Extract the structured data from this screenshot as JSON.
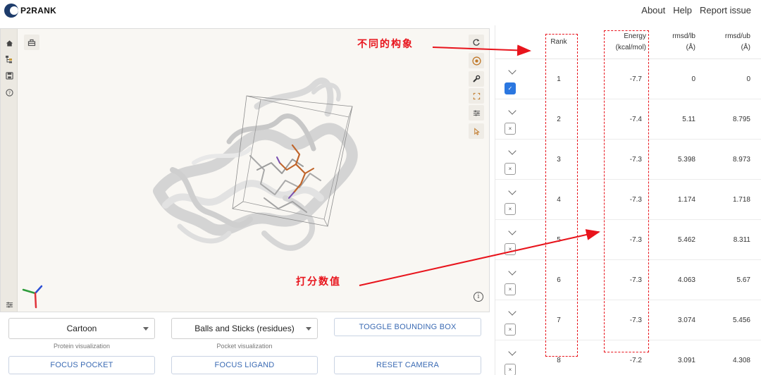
{
  "header": {
    "brand": "P2RANK",
    "links": [
      "About",
      "Help",
      "Report issue"
    ]
  },
  "viewer": {
    "left_icons": [
      "home-icon",
      "hierarchy-icon",
      "save-icon",
      "help-icon"
    ],
    "bottom_icon": "sliders-icon",
    "right_icons": [
      "refresh-icon",
      "aperture-icon",
      "wrench-icon",
      "expand-icon",
      "sliders-icon",
      "pointer-icon"
    ],
    "top_icon": "layout-icon",
    "info_icon": "info-icon"
  },
  "controls": {
    "protein_select": "Cartoon",
    "protein_caption": "Protein visualization",
    "pocket_select": "Balls and Sticks (residues)",
    "pocket_caption": "Pocket visualization",
    "toggle_bbox": "TOGGLE BOUNDING BOX",
    "focus_pocket": "FOCUS POCKET",
    "focus_ligand": "FOCUS LIGAND",
    "reset_camera": "RESET CAMERA"
  },
  "table": {
    "headers": {
      "rank": "Rank",
      "energy_1": "Energy",
      "energy_2": "(kcal/mol)",
      "rmsd_lb_1": "rmsd/lb",
      "rmsd_lb_2": "(Å)",
      "rmsd_ub_1": "rmsd/ub",
      "rmsd_ub_2": "(Å)"
    },
    "rows": [
      {
        "rank": "1",
        "energy": "-7.7",
        "rmsd_lb": "0",
        "rmsd_ub": "0",
        "checked": true
      },
      {
        "rank": "2",
        "energy": "-7.4",
        "rmsd_lb": "5.11",
        "rmsd_ub": "8.795",
        "checked": false
      },
      {
        "rank": "3",
        "energy": "-7.3",
        "rmsd_lb": "5.398",
        "rmsd_ub": "8.973",
        "checked": false
      },
      {
        "rank": "4",
        "energy": "-7.3",
        "rmsd_lb": "1.174",
        "rmsd_ub": "1.718",
        "checked": false
      },
      {
        "rank": "5",
        "energy": "-7.3",
        "rmsd_lb": "5.462",
        "rmsd_ub": "8.311",
        "checked": false
      },
      {
        "rank": "6",
        "energy": "-7.3",
        "rmsd_lb": "4.063",
        "rmsd_ub": "5.67",
        "checked": false
      },
      {
        "rank": "7",
        "energy": "-7.3",
        "rmsd_lb": "3.074",
        "rmsd_ub": "5.456",
        "checked": false
      },
      {
        "rank": "8",
        "energy": "-7.2",
        "rmsd_lb": "3.091",
        "rmsd_ub": "4.308",
        "checked": false
      }
    ]
  },
  "annotations": {
    "conformations": "不同的构象",
    "scores": "打分数值",
    "color": "#e8141c"
  }
}
